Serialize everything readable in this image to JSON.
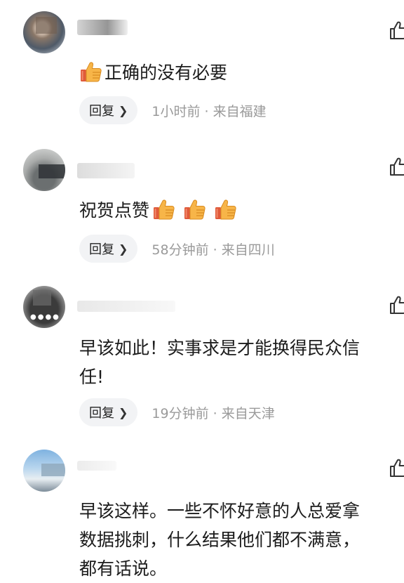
{
  "comments": [
    {
      "text": "正确的没有必要",
      "emoji_count": 1,
      "emoji_position": "before",
      "reply_label": "回复",
      "time": "1小时前",
      "location": "来自福建",
      "separator": " · "
    },
    {
      "text": "祝贺点赞",
      "emoji_count": 3,
      "emoji_position": "after",
      "reply_label": "回复",
      "time": "58分钟前",
      "location": "来自四川",
      "separator": " · "
    },
    {
      "text_lines": [
        "早该如此！实事求是才能换得民众信",
        "任!"
      ],
      "reply_label": "回复",
      "time": "19分钟前",
      "location": "来自天津",
      "separator": " · "
    },
    {
      "text_lines": [
        "早该这样。一些不怀好意的人总爱拿",
        "数据挑刺，什么结果他们都不满意，",
        "都有话说。"
      ]
    }
  ],
  "icons": {
    "like": "thumbs-up-outline-icon",
    "emoji": "thumbs-up-emoji-icon"
  },
  "colors": {
    "meta_text": "#9a9a9a",
    "reply_bg": "#f2f3f5",
    "emoji_skin": "#f7b548",
    "emoji_cuff": "#e05a3a"
  }
}
